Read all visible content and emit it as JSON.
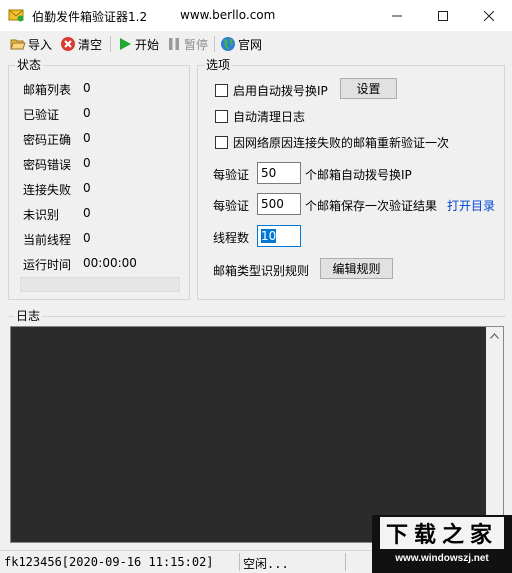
{
  "window": {
    "title": "伯勤发件箱验证器1.2",
    "url": "www.berllo.com",
    "icon": "app-envelope-icon"
  },
  "toolbar": {
    "import_label": "导入",
    "clear_label": "清空",
    "start_label": "开始",
    "pause_label": "暂停",
    "website_label": "官网"
  },
  "status": {
    "title": "状态",
    "rows": [
      {
        "label": "邮箱列表",
        "value": "0"
      },
      {
        "label": "已验证",
        "value": "0"
      },
      {
        "label": "密码正确",
        "value": "0"
      },
      {
        "label": "密码错误",
        "value": "0"
      },
      {
        "label": "连接失败",
        "value": "0"
      },
      {
        "label": "未识别",
        "value": "0"
      },
      {
        "label": "当前线程",
        "value": "0"
      },
      {
        "label": "运行时间",
        "value": "00:00:00"
      }
    ],
    "progress": 0
  },
  "options": {
    "title": "选项",
    "auto_dial_label": "启用自动拨号换IP",
    "settings_button": "设置",
    "auto_clean_label": "自动清理日志",
    "retry_label": "因网络原因连接失败的邮箱重新验证一次",
    "every_verify_1": "每验证",
    "dial_count": "50",
    "dial_suffix": "个邮箱自动拨号换IP",
    "every_verify_2": "每验证",
    "save_count": "500",
    "save_suffix": "个邮箱保存一次验证结果",
    "open_dir_link": "打开目录",
    "threads_label": "线程数",
    "threads_value": "10",
    "rules_label": "邮箱类型识别规则",
    "edit_rules_button": "编辑规则"
  },
  "log": {
    "title": "日志"
  },
  "statusbar": {
    "user_time": "fk123456[2020-09-16 11:15:02]",
    "state": "空闲..."
  },
  "watermark": {
    "top": "下载之家",
    "bottom": "www.windowszj.net"
  }
}
